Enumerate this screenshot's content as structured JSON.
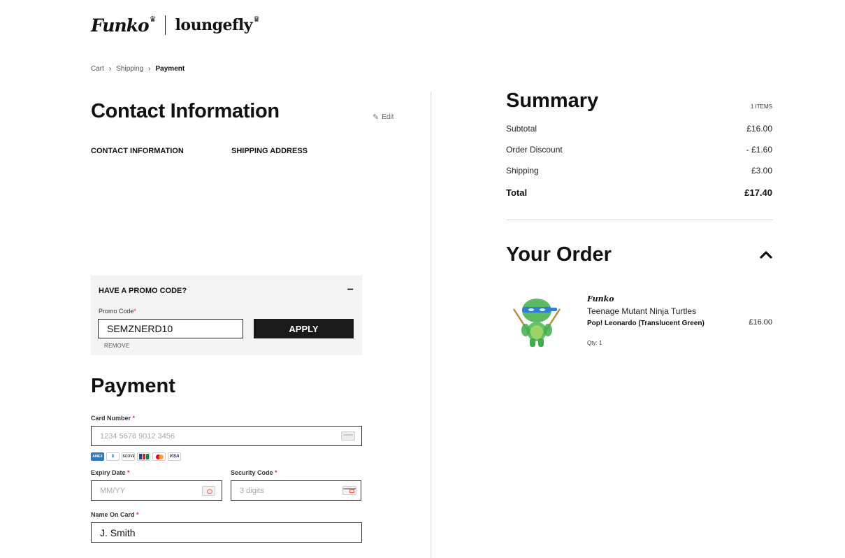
{
  "header": {
    "brand_funko": "Funko",
    "brand_loungefly": "loungefly"
  },
  "breadcrumb": {
    "items": [
      "Cart",
      "Shipping",
      "Payment"
    ],
    "separator": "›"
  },
  "contact": {
    "title": "Contact Information",
    "edit_label": "Edit",
    "contact_heading": "CONTACT INFORMATION",
    "shipping_heading": "SHIPPING ADDRESS"
  },
  "promo": {
    "title": "HAVE A PROMO CODE?",
    "toggle": "−",
    "label": "Promo Code",
    "required_mark": "*",
    "value": "SEMZNERD10",
    "apply_label": "APPLY",
    "remove_label": "REMOVE"
  },
  "payment": {
    "title": "Payment",
    "card_number_label": "Card Number",
    "card_number_placeholder": "1234 5678 9012 3456",
    "expiry_label": "Expiry Date",
    "expiry_placeholder": "MM/YY",
    "security_label": "Security Code",
    "security_placeholder": "3 digits",
    "name_label": "Name On Card",
    "name_value": "J. Smith",
    "required_mark": "*",
    "card_brands": [
      "amex-icon",
      "diners-icon",
      "discover-icon",
      "jcb-icon",
      "mastercard-icon",
      "visa-icon"
    ],
    "card_brand_texts": {
      "amex": "AMEX",
      "diners": "D",
      "discover": "DISCOVER",
      "visa": "VISA"
    }
  },
  "summary": {
    "title": "Summary",
    "items_count": "1 ITEMS",
    "rows": [
      {
        "label": "Subtotal",
        "value": "£16.00"
      },
      {
        "label": "Order Discount",
        "value": "- £1.60"
      },
      {
        "label": "Shipping",
        "value": "£3.00"
      }
    ],
    "total_label": "Total",
    "total_value": "£17.40"
  },
  "order": {
    "title": "Your Order",
    "product": {
      "brand": "Funko",
      "series": "Teenage Mutant Ninja Turtles",
      "name": "Pop! Leonardo (Translucent Green)",
      "qty": "Qty: 1",
      "price": "£16.00"
    }
  },
  "colors": {
    "accent": "#1a1a1a",
    "required": "#dd3333",
    "panel": "#f4f4f4"
  }
}
